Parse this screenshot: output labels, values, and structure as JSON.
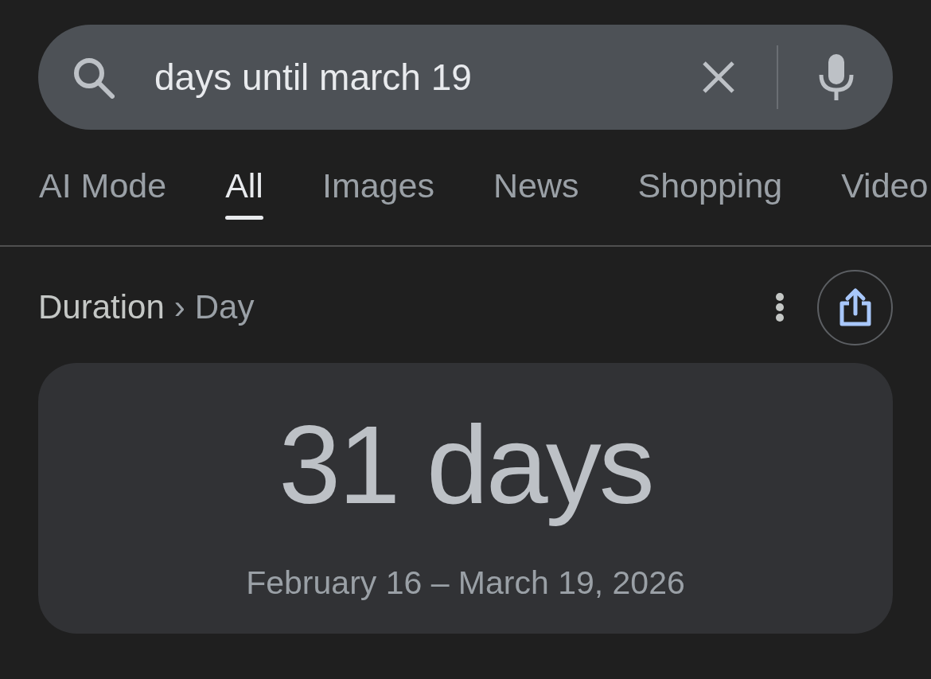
{
  "search": {
    "query": "days until march 19"
  },
  "tabs": [
    {
      "label": "AI Mode",
      "selected": false
    },
    {
      "label": "All",
      "selected": true
    },
    {
      "label": "Images",
      "selected": false
    },
    {
      "label": "News",
      "selected": false
    },
    {
      "label": "Shopping",
      "selected": false
    },
    {
      "label": "Video",
      "selected": false
    }
  ],
  "breadcrumb": {
    "items": [
      "Duration",
      "Day"
    ],
    "separator": "›"
  },
  "result": {
    "value": "31 days",
    "date_range": "February 16 – March 19, 2026"
  }
}
